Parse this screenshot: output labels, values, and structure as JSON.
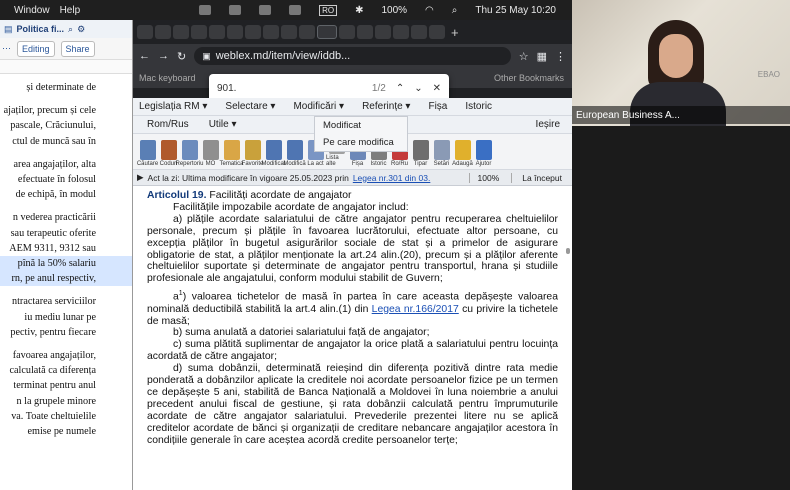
{
  "menubar": {
    "items": [
      "Window",
      "Help"
    ],
    "battery": "100%",
    "date_time": "Thu 25 May  10:20",
    "ro": "RO"
  },
  "word": {
    "doc_title": "Politica fi...",
    "editing": "Editing",
    "share": "Share",
    "lines": [
      "și determinate de",
      "",
      "ajaților, precum și cele",
      "pascale, Crăciunului,",
      "ctul de muncă sau în",
      "",
      "area angajaților, alta",
      "efectuate în folosul",
      "de echipă, în modul",
      "",
      "n vederea practicării",
      "sau terapeutic oferite",
      "AEM 9311, 9312 sau",
      "pînă la 50% salariu",
      "rn, pe anul respectiv,",
      "",
      "ntractarea serviciilor",
      "iu mediu lunar pe",
      "pectiv, pentru fiecare",
      "",
      "favoarea angajaților,",
      "calculată ca diferența",
      "terminat pentru anul",
      "n la grupele minore",
      "va. Toate cheltuielile",
      "emise pe numele"
    ]
  },
  "browser": {
    "url": "weblex.md/item/view/iddb...",
    "bookmark_left": "Mac keyboard",
    "bookmark_right": "Other Bookmarks"
  },
  "find": {
    "query": "901.",
    "count": "1/2"
  },
  "nav": {
    "row1": [
      "Legislația RM",
      "Selectare",
      "Modificări",
      "Referințe",
      "Fișa",
      "Istoric"
    ],
    "row2": [
      "Rom/Rus",
      "Utile"
    ],
    "exit": "Ieșire"
  },
  "dropdown": [
    "Modificat",
    "Pe care modifica"
  ],
  "icons": [
    {
      "label": "Căutare",
      "color": "#5a7fb5"
    },
    {
      "label": "Coduri",
      "color": "#b05a2c"
    },
    {
      "label": "Repertoriu",
      "color": "#6c8cbd"
    },
    {
      "label": "MO",
      "color": "#8f8f8f"
    },
    {
      "label": "Tematica",
      "color": "#d9a646"
    },
    {
      "label": "Favorite",
      "color": "#c9a13b"
    },
    {
      "label": "Modificat",
      "color": "#4f75b2"
    },
    {
      "label": "Modifică",
      "color": "#4f75b2"
    },
    {
      "label": "La act",
      "color": "#7a95c4"
    },
    {
      "label": "Lista alte",
      "color": "#a0a0a0"
    },
    {
      "label": "Fișa",
      "color": "#6d88b8"
    },
    {
      "label": "Istoric",
      "color": "#7d7d7d"
    },
    {
      "label": "Ro/Ru",
      "color": "#c43a3a"
    },
    {
      "label": "Tipar",
      "color": "#6e6e6e"
    },
    {
      "label": "Setări",
      "color": "#8a9ab5"
    },
    {
      "label": "Adaugă",
      "color": "#e0b02c"
    },
    {
      "label": "Ajutor",
      "color": "#3a6fc4"
    }
  ],
  "status": {
    "prefix": "Act la zi: Ultima modificare în vigoare 25.05.2023 prin ",
    "link": "Legea nr.301 din 03.",
    "zoom": "100%",
    "start": "La început"
  },
  "article": {
    "title": "Articolul 19.",
    "title_rest": " Facilități acordate de angajator",
    "intro": "Facilitățile impozabile acordate de angajator includ:",
    "a": "a) plățile acordate salariatului de către angajator pentru recuperarea cheltuielilor personale, precum și plățile în favoarea lucrătorului, efectuate altor persoane, cu excepția plăților în bugetul asigurărilor sociale de stat și a primelor de asigurare obligatorie de stat, a plăților menționate la art.24 alin.(20), precum și a plăților aferente cheltuielilor suportate și determinate de angajator pentru transportul, hrana și studiile profesionale ale angajatului, conform modului stabilit de Guvern;",
    "a1_pre": "a",
    "a1_sup": "1",
    "a1_text": ") valoarea tichetelor de masă în partea în care aceasta depășește valoarea nominală deductibilă stabilită la art.4 alin.(1) din ",
    "a1_link": "Legea nr.166/2017",
    "a1_end": " cu privire la tichetele de masă;",
    "b": "b) suma anulată a datoriei salariatului față de angajator;",
    "c": "c) suma plătită suplimentar de angajator la orice plată a salariatului pentru locuința acordată de către angajator;",
    "d": "d) suma dobânzii, determinată reieșind din diferența pozitivă dintre rata medie ponderată a dobânzilor aplicate la creditele noi acordate persoanelor fizice pe un termen ce depășește 5 ani, stabilită de Banca Națională a Moldovei în luna noiembrie a anului precedent anului fiscal de gestiune, și rata dobânzii calculată pentru împrumuturile acordate de către angajator salariatului. Prevederile prezentei litere nu se aplică creditelor acordate de bănci și organizații de creditare nebancare angajaților acestora în condițiile generale în care aceștea acordă credite persoanelor terțe;"
  },
  "video": {
    "participant": "European Business A...",
    "logo_text": "EBAO"
  }
}
